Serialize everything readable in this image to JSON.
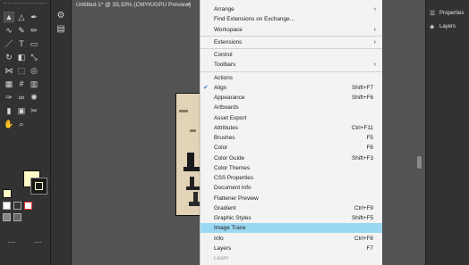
{
  "document_tab": {
    "title": "Untitled-1* @ 33,33% (CMYK/GPU Preview)",
    "close_glyph": "×"
  },
  "toolbar": {
    "tools": [
      "select",
      "direct-select",
      "pen",
      "curvature",
      "brush",
      "pencil",
      "line",
      "type",
      "rectangle",
      "rotate",
      "eraser",
      "scale",
      "width",
      "free-transform",
      "shape-builder",
      "perspective",
      "mesh",
      "gradient",
      "eyedropper",
      "blend",
      "symbol-sprayer",
      "column-graph",
      "artboard",
      "slice",
      "hand",
      "zoom"
    ],
    "fill_color": "#fffbc8",
    "stroke_color": "#1a1a1a",
    "more_glyph": "···"
  },
  "menu": {
    "items": [
      {
        "label": "Arrange",
        "submenu": true
      },
      {
        "label": "Find Extensions on Exchange..."
      },
      {
        "label": "Workspace",
        "submenu": true
      },
      {
        "sep": true
      },
      {
        "label": "Extensions",
        "submenu": true
      },
      {
        "sep": true
      },
      {
        "label": "Control"
      },
      {
        "label": "Toolbars",
        "submenu": true
      },
      {
        "sep": true
      },
      {
        "label": "Actions"
      },
      {
        "label": "Align",
        "shortcut": "Shift+F7",
        "checked": true
      },
      {
        "label": "Appearance",
        "shortcut": "Shift+F6"
      },
      {
        "label": "Artboards"
      },
      {
        "label": "Asset Export"
      },
      {
        "label": "Attributes",
        "shortcut": "Ctrl+F11"
      },
      {
        "label": "Brushes",
        "shortcut": "F5"
      },
      {
        "label": "Color",
        "shortcut": "F6"
      },
      {
        "label": "Color Guide",
        "shortcut": "Shift+F3"
      },
      {
        "label": "Color Themes"
      },
      {
        "label": "CSS Properties"
      },
      {
        "label": "Document Info"
      },
      {
        "label": "Flattener Preview"
      },
      {
        "label": "Gradient",
        "shortcut": "Ctrl+F9"
      },
      {
        "label": "Graphic Styles",
        "shortcut": "Shift+F5"
      },
      {
        "label": "Image Trace",
        "highlighted": true
      },
      {
        "label": "Info",
        "shortcut": "Ctrl+F8"
      },
      {
        "label": "Layers",
        "shortcut": "F7"
      },
      {
        "label": "Learn",
        "disabled": true
      }
    ]
  },
  "dock": {
    "properties_label": "Properties",
    "layers_label": "Layers"
  },
  "colors": {
    "menu_highlight": "#9bd8f2",
    "check_mark": "#2d7ad6",
    "canvas": "#535353",
    "panel": "#323232"
  }
}
